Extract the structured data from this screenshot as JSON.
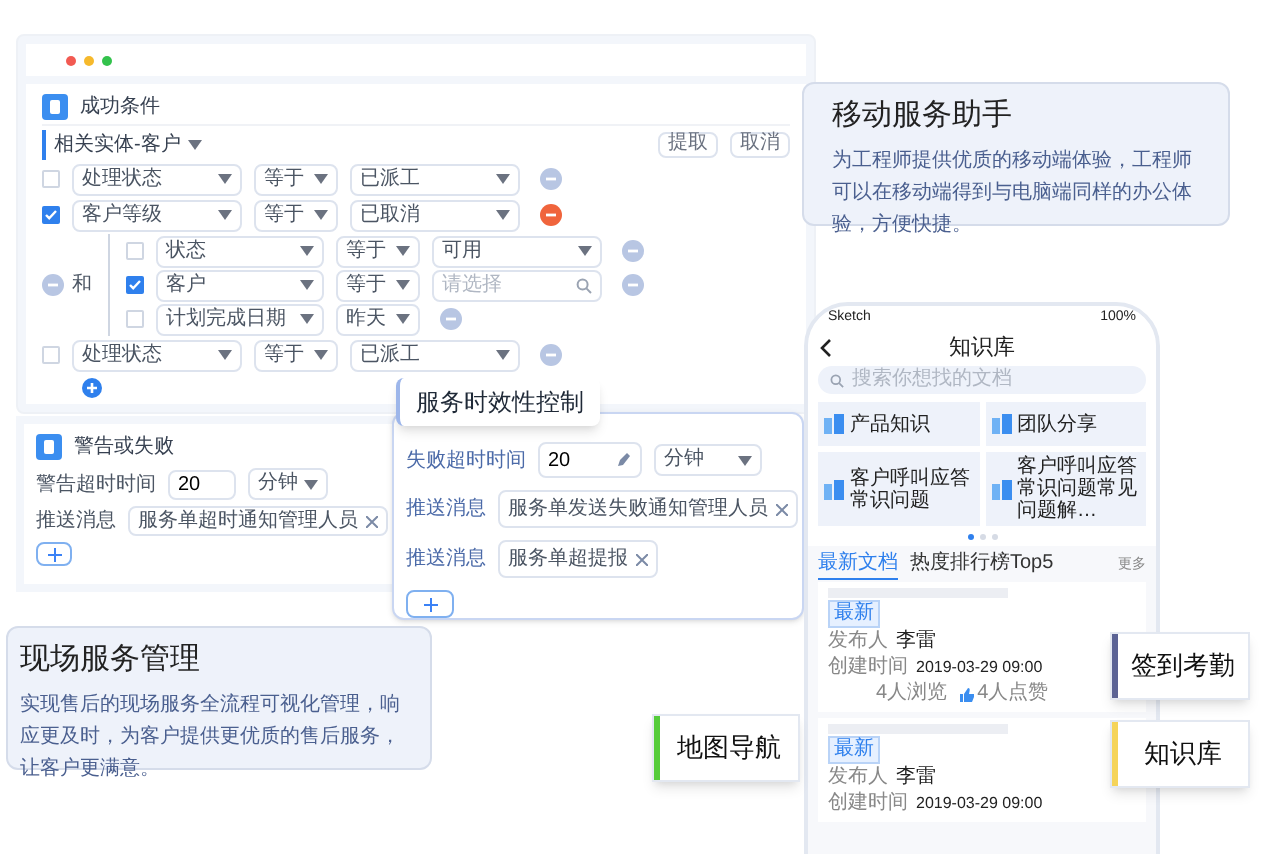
{
  "rules_window": {
    "section_title": "成功条件",
    "entity": "相关实体-客户",
    "actions": [
      "提取",
      "取消"
    ],
    "rows": [
      {
        "kind": "condition",
        "checked": false,
        "field": "处理状态",
        "operator": "等于",
        "value": "已派工",
        "remove_active": false
      },
      {
        "kind": "condition",
        "checked": true,
        "field": "客户等级",
        "operator": "等于",
        "value": "已取消",
        "remove_active": true
      },
      {
        "kind": "group",
        "connector": "和",
        "children": [
          {
            "kind": "condition",
            "checked": false,
            "field": "状态",
            "operator": "等于",
            "value": "可用",
            "remove_active": false
          },
          {
            "kind": "search",
            "checked": true,
            "field": "客户",
            "operator": "等于",
            "placeholder": "请选择",
            "remove_active": false
          },
          {
            "kind": "short",
            "checked": false,
            "field": "计划完成日期",
            "operator": "昨天",
            "remove_active": false
          }
        ]
      },
      {
        "kind": "condition",
        "checked": false,
        "field": "处理状态",
        "operator": "等于",
        "value": "已派工",
        "remove_active": false
      }
    ]
  },
  "warning_panel": {
    "section_title": "警告或失败",
    "timeout_label": "警告超时时间",
    "timeout_value": "20",
    "unit": "分钟",
    "message_label": "推送消息",
    "message_tag": "服务单超时通知管理人员"
  },
  "time_control": {
    "title": "服务时效性控制",
    "timeout_label": "失败超时时间",
    "timeout_value": "20",
    "unit": "分钟",
    "messages": [
      {
        "label": "推送消息",
        "tag": "服务单发送失败通知管理人员"
      },
      {
        "label": "推送消息",
        "tag": "服务单超提报"
      }
    ]
  },
  "field_service_card": {
    "title": "现场服务管理",
    "text": "实现售后的现场服务全流程可视化管理，响应更及时，为客户提供更优质的售后服务，让客户更满意。"
  },
  "mobile_card": {
    "title": "移动服务助手",
    "text": "为工程师提供优质的移动端体验，工程师可以在移动端得到与电脑端同样的办公体验，方便快捷。"
  },
  "phone": {
    "carrier": "Sketch",
    "battery": "100%",
    "title": "知识库",
    "search_placeholder": "搜索你想找的文档",
    "categories": [
      "产品知识",
      "团队分享",
      "客户呼叫应答常识问题",
      "客户呼叫应答常识问题常见问题解…"
    ],
    "pages": [
      {
        "selected": true
      },
      {
        "selected": false
      },
      {
        "selected": false
      }
    ],
    "tabs": [
      {
        "label": "最新文档",
        "selected": true
      },
      {
        "label": "热度排行榜Top5",
        "selected": false
      }
    ],
    "more": "更多",
    "articles": [
      {
        "badge": "最新",
        "publisher_label": "发布人",
        "publisher": "李雷",
        "created_label": "创建时间",
        "created": "2019-03-29 09:00",
        "views": "4人浏览",
        "likes": "4人点赞"
      },
      {
        "badge": "最新",
        "publisher_label": "发布人",
        "publisher": "李雷",
        "created_label": "创建时间",
        "created": "2019-03-29 09:00"
      }
    ]
  },
  "feature_labels": [
    {
      "text": "签到考勤",
      "color": "#5b6395"
    },
    {
      "text": "知识库",
      "color": "#f5d45a"
    },
    {
      "text": "地图导航",
      "color": "#55cc3a"
    }
  ]
}
